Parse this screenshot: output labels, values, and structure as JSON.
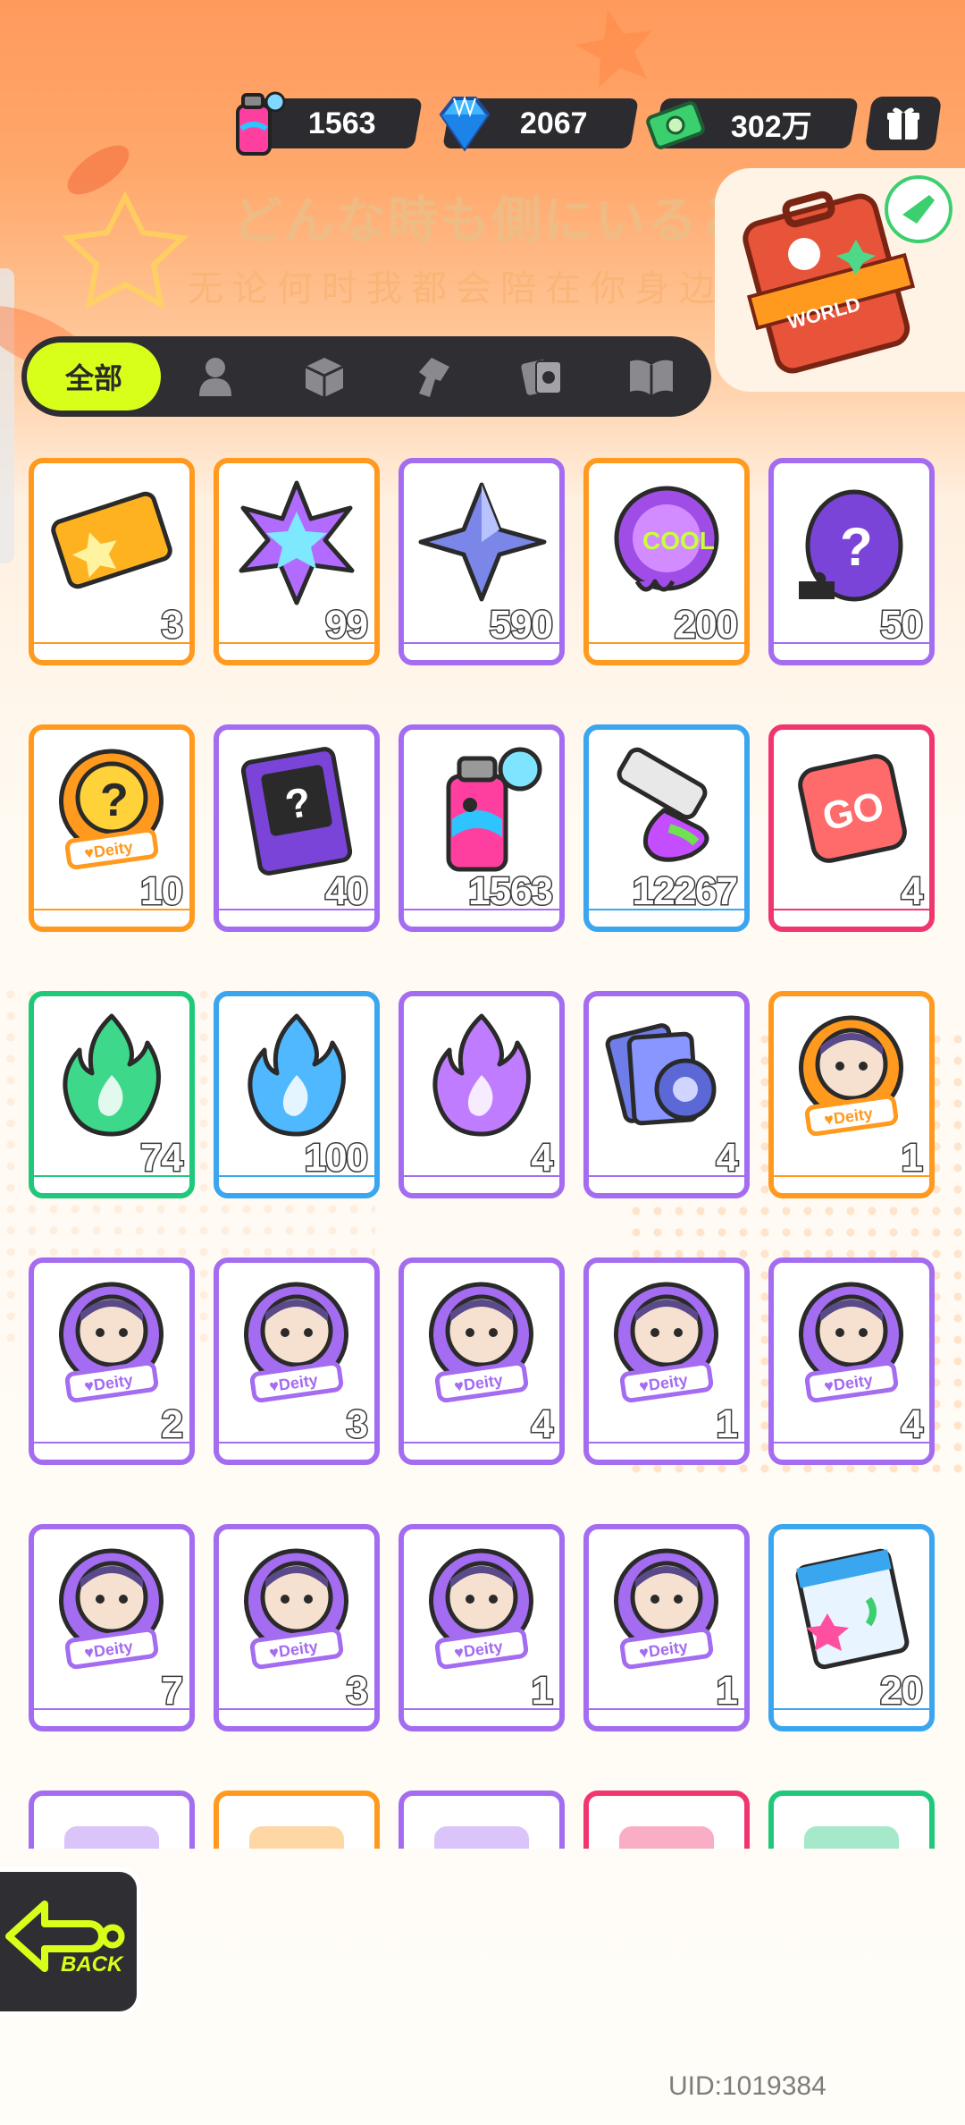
{
  "currency": {
    "spray": {
      "value": "1563",
      "icon": "spray-can-icon"
    },
    "diamond": {
      "value": "2067",
      "icon": "diamond-icon"
    },
    "cash": {
      "value": "302万",
      "icon": "cash-icon"
    }
  },
  "banner": {
    "japanese_text": "どんな時も側にいると",
    "chinese_text": "无论何时我都会陪在你身边",
    "case_label": "WORLD"
  },
  "tabs": [
    {
      "label": "全部",
      "icon": "all",
      "active": true
    },
    {
      "label": "",
      "icon": "person-icon"
    },
    {
      "label": "",
      "icon": "box-icon"
    },
    {
      "label": "",
      "icon": "spray-gun-icon"
    },
    {
      "label": "",
      "icon": "cards-icon"
    },
    {
      "label": "",
      "icon": "book-icon"
    }
  ],
  "items": [
    {
      "count": "3",
      "frame": "#ff9a1f",
      "icon": "ticket-icon"
    },
    {
      "count": "99",
      "frame": "#ff9a1f",
      "icon": "rainbow-star-icon"
    },
    {
      "count": "590",
      "frame": "#a46cf0",
      "icon": "blue-star-icon"
    },
    {
      "count": "200",
      "frame": "#ff9a1f",
      "icon": "cool-badge-icon"
    },
    {
      "count": "50",
      "frame": "#a46cf0",
      "icon": "mystery-egg-icon"
    },
    {
      "count": "10",
      "frame": "#ff9a1f",
      "icon": "deity-mystery-icon"
    },
    {
      "count": "40",
      "frame": "#a46cf0",
      "icon": "travel-card-icon"
    },
    {
      "count": "1563",
      "frame": "#a46cf0",
      "icon": "spray-can-icon"
    },
    {
      "count": "12267",
      "frame": "#3aa6ef",
      "icon": "paint-tube-icon"
    },
    {
      "count": "4",
      "frame": "#f0356f",
      "icon": "go-dice-icon"
    },
    {
      "count": "74",
      "frame": "#20c97a",
      "icon": "green-flame-icon"
    },
    {
      "count": "100",
      "frame": "#3aa6ef",
      "icon": "blue-flame-icon"
    },
    {
      "count": "4",
      "frame": "#a46cf0",
      "icon": "purple-flame-icon"
    },
    {
      "count": "4",
      "frame": "#a46cf0",
      "icon": "card-stack-icon"
    },
    {
      "count": "1",
      "frame": "#ff9a1f",
      "icon": "deity-portrait-icon"
    },
    {
      "count": "2",
      "frame": "#a46cf0",
      "icon": "deity-portrait-icon"
    },
    {
      "count": "3",
      "frame": "#a46cf0",
      "icon": "deity-portrait-icon"
    },
    {
      "count": "4",
      "frame": "#a46cf0",
      "icon": "deity-portrait-icon"
    },
    {
      "count": "1",
      "frame": "#a46cf0",
      "icon": "deity-portrait-icon"
    },
    {
      "count": "4",
      "frame": "#a46cf0",
      "icon": "deity-portrait-icon"
    },
    {
      "count": "7",
      "frame": "#a46cf0",
      "icon": "deity-portrait-icon"
    },
    {
      "count": "3",
      "frame": "#a46cf0",
      "icon": "deity-portrait-icon"
    },
    {
      "count": "1",
      "frame": "#a46cf0",
      "icon": "deity-portrait-icon"
    },
    {
      "count": "1",
      "frame": "#a46cf0",
      "icon": "deity-portrait-icon"
    },
    {
      "count": "20",
      "frame": "#3aa6ef",
      "icon": "sticker-pack-icon"
    },
    {
      "count": "",
      "frame": "#a46cf0",
      "icon": "item-icon"
    },
    {
      "count": "",
      "frame": "#ff9a1f",
      "icon": "item-icon"
    },
    {
      "count": "",
      "frame": "#a46cf0",
      "icon": "item-icon"
    },
    {
      "count": "",
      "frame": "#f0356f",
      "icon": "item-icon"
    },
    {
      "count": "",
      "frame": "#20c97a",
      "icon": "item-icon"
    }
  ],
  "deity_label": "Deity",
  "back": {
    "label": "BACK"
  },
  "uid": "UID:1019384"
}
